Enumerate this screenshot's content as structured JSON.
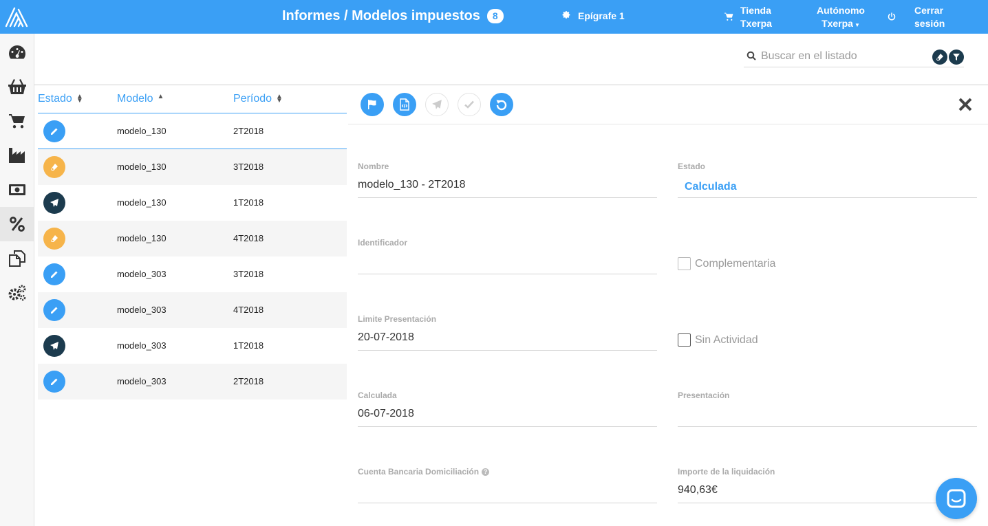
{
  "header": {
    "title": "Informes / Modelos impuestos",
    "badge_count": "8",
    "epigrafe": "Epígrafe 1",
    "tienda_line1": "Tienda",
    "tienda_line2": "Txerpa",
    "user_line1": "Autónomo",
    "user_line2": "Txerpa",
    "logout_line1": "Cerrar",
    "logout_line2": "sesión"
  },
  "sidebar": {
    "items": [
      "dashboard-icon",
      "basket-icon",
      "cart-icon",
      "factory-icon",
      "money-icon",
      "percent-icon",
      "documents-icon",
      "settings-icon"
    ],
    "active": "percent-icon"
  },
  "search": {
    "placeholder": "Buscar en el listado"
  },
  "table": {
    "columns": [
      "Estado",
      "Modelo",
      "Período"
    ],
    "sorted_column": "Modelo",
    "rows": [
      {
        "estado": "edit",
        "modelo": "modelo_130",
        "periodo": "2T2018"
      },
      {
        "estado": "calculated",
        "modelo": "modelo_130",
        "periodo": "3T2018"
      },
      {
        "estado": "sent",
        "modelo": "modelo_130",
        "periodo": "1T2018"
      },
      {
        "estado": "calculated",
        "modelo": "modelo_130",
        "periodo": "4T2018"
      },
      {
        "estado": "edit",
        "modelo": "modelo_303",
        "periodo": "3T2018"
      },
      {
        "estado": "edit",
        "modelo": "modelo_303",
        "periodo": "4T2018"
      },
      {
        "estado": "sent",
        "modelo": "modelo_303",
        "periodo": "1T2018"
      },
      {
        "estado": "edit",
        "modelo": "modelo_303",
        "periodo": "2T2018"
      }
    ]
  },
  "toolbar": [
    "flag-icon",
    "code-file-icon",
    "send-icon",
    "check-icon",
    "undo-icon"
  ],
  "form": {
    "nombre_label": "Nombre",
    "nombre_value": "modelo_130 - 2T2018",
    "estado_label": "Estado",
    "estado_value": "Calculada",
    "identificador_label": "Identificador",
    "identificador_value": "",
    "complementaria_label": "Complementaria",
    "limite_label": "Limite Presentación",
    "limite_value": "20-07-2018",
    "sin_actividad_label": "Sin Actividad",
    "calculada_label": "Calculada",
    "calculada_value": "06-07-2018",
    "presentacion_label": "Presentación",
    "presentacion_value": "",
    "cuenta_label": "Cuenta Bancaria Domiciliación",
    "cuenta_value": "",
    "importe_label": "Importe de la liquidación",
    "importe_value": "940,63€"
  },
  "colors": {
    "accent": "#3a9ff5",
    "dark": "#1c3b4e",
    "orange": "#f6b44a"
  }
}
